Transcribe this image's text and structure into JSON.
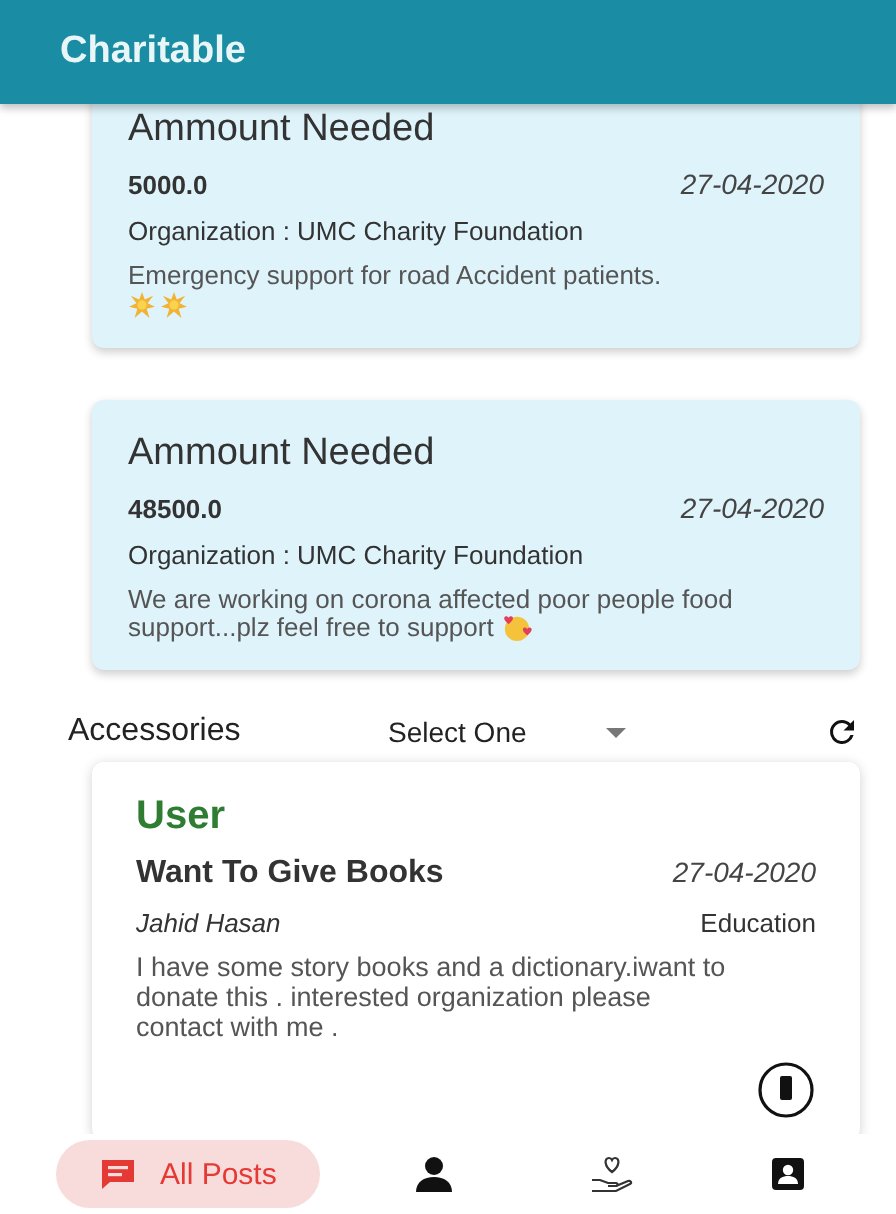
{
  "app_bar": {
    "title": "Charitable"
  },
  "needs": [
    {
      "heading": "Ammount Needed",
      "amount": "5000.0",
      "date": "27-04-2020",
      "organization": "Organization : UMC Charity Foundation",
      "description": "Emergency support for road Accident patients.",
      "decorations": [
        {
          "kind": "burst"
        },
        {
          "kind": "burst"
        }
      ]
    },
    {
      "heading": "Ammount Needed",
      "amount": "48500.0",
      "date": "27-04-2020",
      "organization": "Organization : UMC Charity Foundation",
      "description": "We are working on corona affected poor people food support...plz feel free to support",
      "decorations": [
        {
          "kind": "hearts"
        }
      ]
    }
  ],
  "filter": {
    "label": "Accessories",
    "dropdown": {
      "value": "Select One"
    }
  },
  "posts": [
    {
      "role": "User",
      "title": "Want To Give Books",
      "date": "27-04-2020",
      "author": "Jahid Hasan",
      "category": "Education",
      "description": "I have some story books and a dictionary.iwant to donate this . interested organization please contact with me ."
    }
  ],
  "bottom_nav": [
    {
      "kind": "posts",
      "label": "All Posts",
      "selected": true
    },
    {
      "kind": "person",
      "selected": false
    },
    {
      "kind": "charity",
      "selected": false
    },
    {
      "kind": "profile",
      "selected": false
    }
  ]
}
